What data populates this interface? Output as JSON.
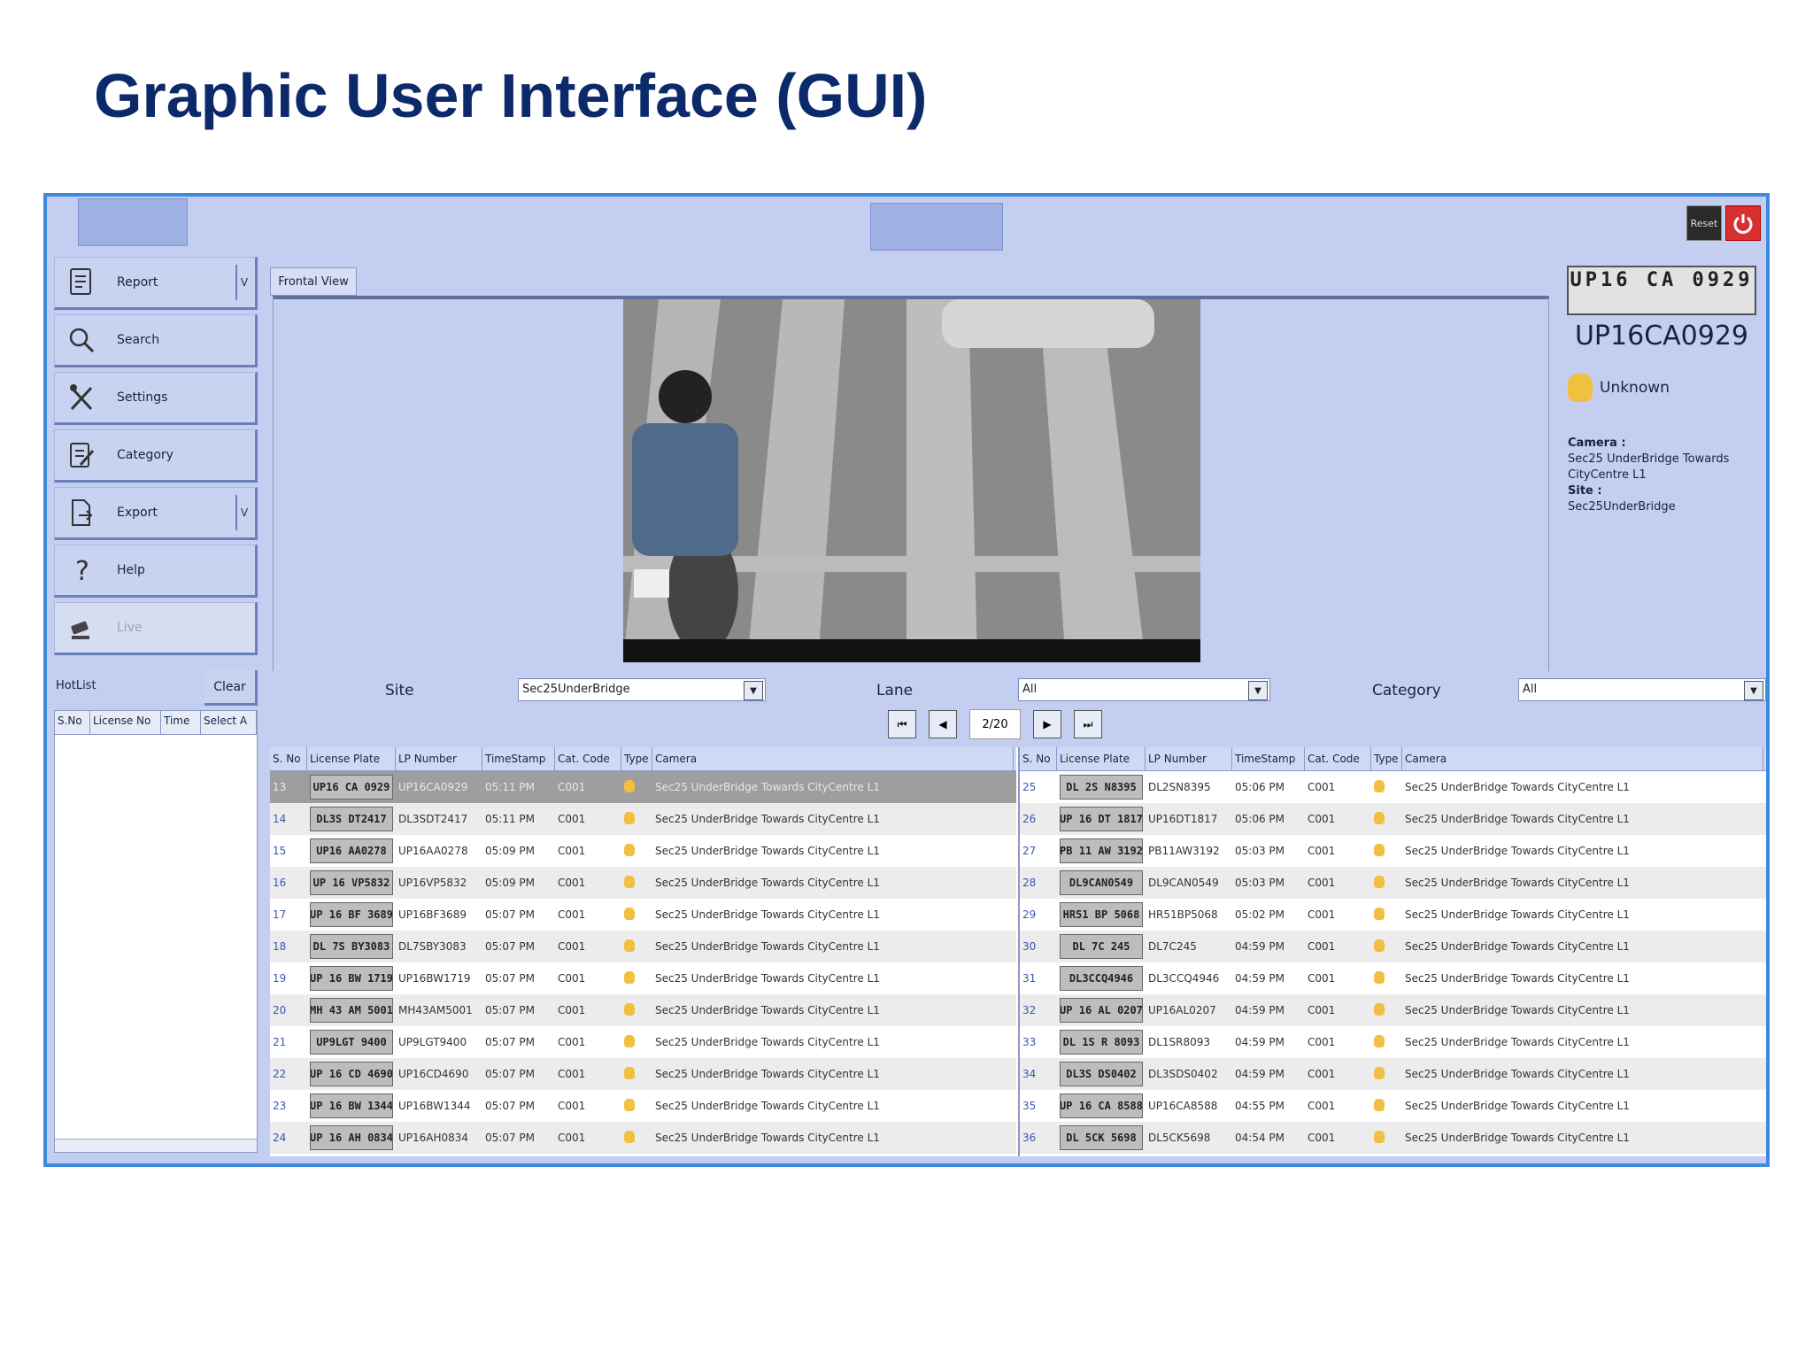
{
  "slide": {
    "title": "Graphic User Interface (GUI)"
  },
  "app": {
    "top": {
      "reset_label": "Reset"
    },
    "sidebar": [
      {
        "label": "Report",
        "icon": "report-icon",
        "has_caret": true,
        "disabled": false
      },
      {
        "label": "Search",
        "icon": "search-icon",
        "has_caret": false,
        "disabled": false
      },
      {
        "label": "Settings",
        "icon": "settings-icon",
        "has_caret": false,
        "disabled": false
      },
      {
        "label": "Category",
        "icon": "category-icon",
        "has_caret": false,
        "disabled": false
      },
      {
        "label": "Export",
        "icon": "export-icon",
        "has_caret": true,
        "disabled": false
      },
      {
        "label": "Help",
        "icon": "help-icon",
        "has_caret": false,
        "disabled": false
      },
      {
        "label": "Live",
        "icon": "camera-icon",
        "has_caret": false,
        "disabled": true
      }
    ],
    "caret_symbol": "V",
    "hotlist": {
      "label": "HotList",
      "clear_label": "Clear",
      "columns": [
        "S.No",
        "License No",
        "Time",
        "Select A"
      ]
    },
    "view": {
      "tab_label": "Frontal View"
    },
    "detail": {
      "plate_image_text": "UP16 CA 0929",
      "plate_number": "UP16CA0929",
      "type_label": "Unknown",
      "camera_label": "Camera :",
      "camera_value": "Sec25 UnderBridge Towards CityCentre L1",
      "site_label": "Site :",
      "site_value": "Sec25UnderBridge"
    },
    "filters": {
      "site_label": "Site",
      "site_value": "Sec25UnderBridge",
      "lane_label": "Lane",
      "lane_value": "All",
      "category_label": "Category",
      "category_value": "All"
    },
    "pager": {
      "page": "2/20"
    },
    "table": {
      "columns": [
        "S. No",
        "License Plate",
        "LP Number",
        "TimeStamp",
        "Cat. Code",
        "Type",
        "Camera"
      ],
      "left_rows": [
        {
          "sno": "13",
          "plate": "UP16 CA 0929",
          "lp": "UP16CA0929",
          "time": "05:11 PM",
          "cat": "C001",
          "camera": "Sec25 UnderBridge Towards CityCentre L1",
          "selected": true
        },
        {
          "sno": "14",
          "plate": "DL3S DT2417",
          "lp": "DL3SDT2417",
          "time": "05:11 PM",
          "cat": "C001",
          "camera": "Sec25 UnderBridge Towards CityCentre L1"
        },
        {
          "sno": "15",
          "plate": "UP16 AA0278",
          "lp": "UP16AA0278",
          "time": "05:09 PM",
          "cat": "C001",
          "camera": "Sec25 UnderBridge Towards CityCentre L1"
        },
        {
          "sno": "16",
          "plate": "UP 16 VP5832",
          "lp": "UP16VP5832",
          "time": "05:09 PM",
          "cat": "C001",
          "camera": "Sec25 UnderBridge Towards CityCentre L1"
        },
        {
          "sno": "17",
          "plate": "UP 16 BF 3689",
          "lp": "UP16BF3689",
          "time": "05:07 PM",
          "cat": "C001",
          "camera": "Sec25 UnderBridge Towards CityCentre L1"
        },
        {
          "sno": "18",
          "plate": "DL 7S BY3083",
          "lp": "DL7SBY3083",
          "time": "05:07 PM",
          "cat": "C001",
          "camera": "Sec25 UnderBridge Towards CityCentre L1"
        },
        {
          "sno": "19",
          "plate": "UP 16 BW 1719",
          "lp": "UP16BW1719",
          "time": "05:07 PM",
          "cat": "C001",
          "camera": "Sec25 UnderBridge Towards CityCentre L1"
        },
        {
          "sno": "20",
          "plate": "MH 43 AM 5001",
          "lp": "MH43AM5001",
          "time": "05:07 PM",
          "cat": "C001",
          "camera": "Sec25 UnderBridge Towards CityCentre L1"
        },
        {
          "sno": "21",
          "plate": "UP9LGT 9400",
          "lp": "UP9LGT9400",
          "time": "05:07 PM",
          "cat": "C001",
          "camera": "Sec25 UnderBridge Towards CityCentre L1"
        },
        {
          "sno": "22",
          "plate": "UP 16 CD 4690",
          "lp": "UP16CD4690",
          "time": "05:07 PM",
          "cat": "C001",
          "camera": "Sec25 UnderBridge Towards CityCentre L1"
        },
        {
          "sno": "23",
          "plate": "UP 16 BW 1344",
          "lp": "UP16BW1344",
          "time": "05:07 PM",
          "cat": "C001",
          "camera": "Sec25 UnderBridge Towards CityCentre L1"
        },
        {
          "sno": "24",
          "plate": "UP 16 AH 0834",
          "lp": "UP16AH0834",
          "time": "05:07 PM",
          "cat": "C001",
          "camera": "Sec25 UnderBridge Towards CityCentre L1"
        }
      ],
      "right_rows": [
        {
          "sno": "25",
          "plate": "DL 2S N8395",
          "lp": "DL2SN8395",
          "time": "05:06 PM",
          "cat": "C001",
          "camera": "Sec25 UnderBridge Towards CityCentre L1"
        },
        {
          "sno": "26",
          "plate": "UP 16 DT 1817",
          "lp": "UP16DT1817",
          "time": "05:06 PM",
          "cat": "C001",
          "camera": "Sec25 UnderBridge Towards CityCentre L1"
        },
        {
          "sno": "27",
          "plate": "PB 11 AW 3192",
          "lp": "PB11AW3192",
          "time": "05:03 PM",
          "cat": "C001",
          "camera": "Sec25 UnderBridge Towards CityCentre L1"
        },
        {
          "sno": "28",
          "plate": "DL9CAN0549",
          "lp": "DL9CAN0549",
          "time": "05:03 PM",
          "cat": "C001",
          "camera": "Sec25 UnderBridge Towards CityCentre L1"
        },
        {
          "sno": "29",
          "plate": "HR51 BP 5068",
          "lp": "HR51BP5068",
          "time": "05:02 PM",
          "cat": "C001",
          "camera": "Sec25 UnderBridge Towards CityCentre L1"
        },
        {
          "sno": "30",
          "plate": "DL 7C 245",
          "lp": "DL7C245",
          "time": "04:59 PM",
          "cat": "C001",
          "camera": "Sec25 UnderBridge Towards CityCentre L1"
        },
        {
          "sno": "31",
          "plate": "DL3CCQ4946",
          "lp": "DL3CCQ4946",
          "time": "04:59 PM",
          "cat": "C001",
          "camera": "Sec25 UnderBridge Towards CityCentre L1"
        },
        {
          "sno": "32",
          "plate": "UP 16 AL 0207",
          "lp": "UP16AL0207",
          "time": "04:59 PM",
          "cat": "C001",
          "camera": "Sec25 UnderBridge Towards CityCentre L1"
        },
        {
          "sno": "33",
          "plate": "DL 1S R 8093",
          "lp": "DL1SR8093",
          "time": "04:59 PM",
          "cat": "C001",
          "camera": "Sec25 UnderBridge Towards CityCentre L1"
        },
        {
          "sno": "34",
          "plate": "DL3S DS0402",
          "lp": "DL3SDS0402",
          "time": "04:59 PM",
          "cat": "C001",
          "camera": "Sec25 UnderBridge Towards CityCentre L1"
        },
        {
          "sno": "35",
          "plate": "UP 16 CA 8588",
          "lp": "UP16CA8588",
          "time": "04:55 PM",
          "cat": "C001",
          "camera": "Sec25 UnderBridge Towards CityCentre L1"
        },
        {
          "sno": "36",
          "plate": "DL 5CK 5698",
          "lp": "DL5CK5698",
          "time": "04:54 PM",
          "cat": "C001",
          "camera": "Sec25 UnderBridge Towards CityCentre L1"
        }
      ]
    },
    "colors": {
      "frame": "#3e8ae0",
      "panel": "#c3cef0",
      "title": "#0c2a6a",
      "selected_row": "#9e9e9e"
    }
  }
}
